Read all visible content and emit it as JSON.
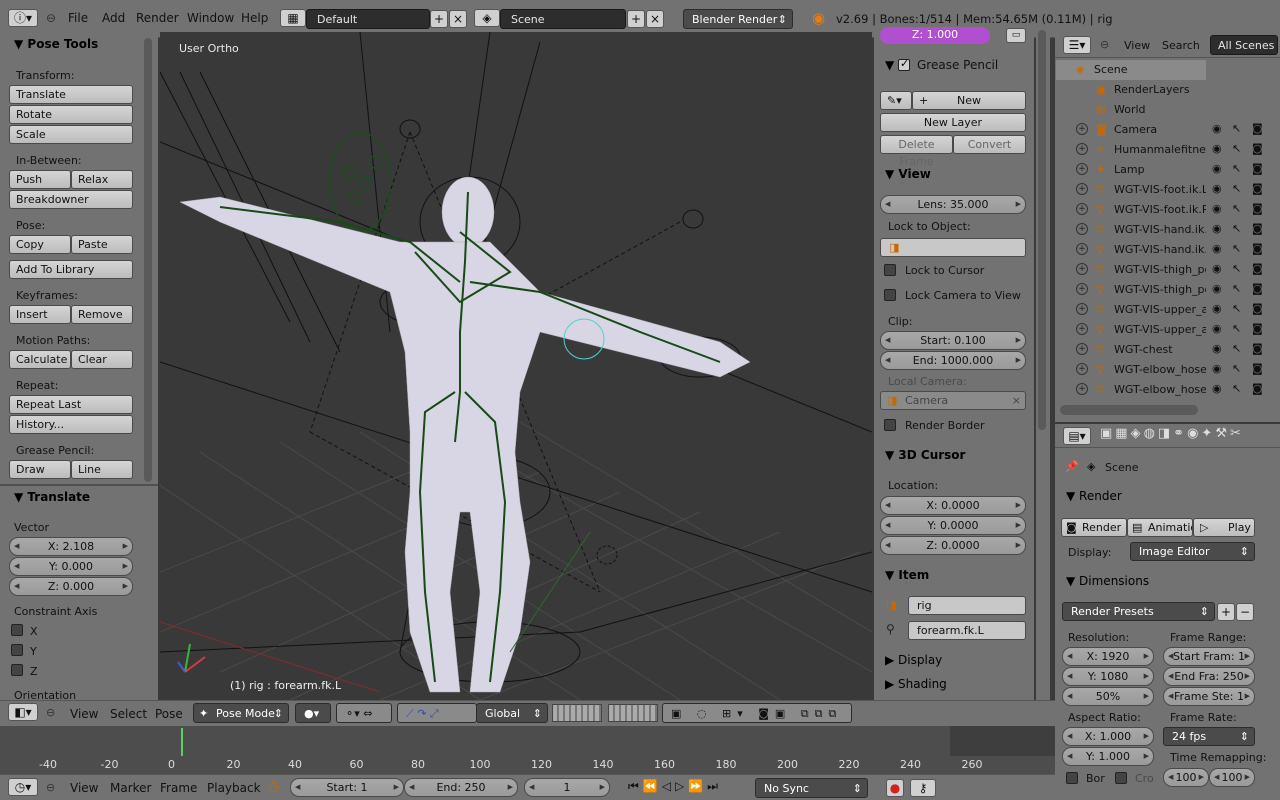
{
  "topbar": {
    "menus": [
      "File",
      "Add",
      "Render",
      "Window",
      "Help"
    ],
    "screen": "Default",
    "scene": "Scene",
    "engine": "Blender Render",
    "status": "v2.69 | Bones:1/514 | Mem:54.65M (0.11M) | rig"
  },
  "tools": {
    "title": "Pose Tools",
    "transform_label": "Transform:",
    "translate": "Translate",
    "rotate": "Rotate",
    "scale": "Scale",
    "inbetween_label": "In-Between:",
    "push": "Push",
    "relax": "Relax",
    "breakdowner": "Breakdowner",
    "pose_label": "Pose:",
    "copy": "Copy",
    "paste": "Paste",
    "add_to_library": "Add To Library",
    "keyframes_label": "Keyframes:",
    "insert": "Insert",
    "remove": "Remove",
    "motion_paths_label": "Motion Paths:",
    "calculate": "Calculate",
    "clear": "Clear",
    "repeat_label": "Repeat:",
    "repeat_last": "Repeat Last",
    "history": "History...",
    "grease_pencil_label": "Grease Pencil:",
    "draw": "Draw",
    "line": "Line"
  },
  "operator": {
    "title": "Translate",
    "vector_label": "Vector",
    "x": "X: 2.108",
    "y": "Y: 0.000",
    "z": "Z: 0.000",
    "constraint_label": "Constraint Axis",
    "cx": "X",
    "cy": "Y",
    "cz": "Z",
    "orientation_label": "Orientation"
  },
  "viewport": {
    "view_name": "User Ortho",
    "object_info": "(1) rig : forearm.fk.L"
  },
  "properties": {
    "z_field": "Z: 1.000",
    "grease_pencil": "Grease Pencil",
    "new": "New",
    "new_layer": "New Layer",
    "delete_frame": "Delete Frame",
    "convert": "Convert",
    "view": "View",
    "lens": "Lens: 35.000",
    "lock_to_object": "Lock to Object:",
    "lock_to_cursor": "Lock to Cursor",
    "lock_camera": "Lock Camera to View",
    "clip": "Clip:",
    "clip_start": "Start: 0.100",
    "clip_end": "End: 1000.000",
    "local_camera": "Local Camera:",
    "camera": "Camera",
    "render_border": "Render Border",
    "cursor_3d": "3D Cursor",
    "location": "Location:",
    "cx": "X: 0.0000",
    "cy": "Y: 0.0000",
    "cz": "Z: 0.0000",
    "item": "Item",
    "item_object": "rig",
    "item_bone": "forearm.fk.L",
    "display": "Display",
    "shading": "Shading"
  },
  "outliner": {
    "view": "View",
    "search": "Search",
    "all_scenes": "All Scenes",
    "rows": [
      "Scene",
      "RenderLayers",
      "World",
      "Camera",
      "Humanmalefitness",
      "Lamp",
      "WGT-VIS-foot.ik.L",
      "WGT-VIS-foot.ik.R",
      "WGT-VIS-hand.ik.L",
      "WGT-VIS-hand.ik.R",
      "WGT-VIS-thigh_pol",
      "WGT-VIS-thigh_pol",
      "WGT-VIS-upper_ar",
      "WGT-VIS-upper_ar",
      "WGT-chest",
      "WGT-elbow_hose.l",
      "WGT-elbow_hose.l"
    ]
  },
  "render_props": {
    "scene": "Scene",
    "render": "Render",
    "render_btn": "Render",
    "animation_btn": "Animatio",
    "play_btn": "Play",
    "display_label": "Display:",
    "display_value": "Image Editor",
    "dimensions": "Dimensions",
    "presets": "Render Presets",
    "resolution": "Resolution:",
    "res_x": "X: 1920",
    "res_y": "Y: 1080",
    "res_pct": "50%",
    "frame_range": "Frame Range:",
    "start_frame": "Start Fram: 1",
    "end_frame": "End Fra: 250",
    "frame_step": "Frame Ste: 1",
    "aspect_ratio": "Aspect Ratio:",
    "asp_x": "X: 1.000",
    "asp_y": "Y: 1.000",
    "frame_rate": "Frame Rate:",
    "fps": "24 fps",
    "time_remap": "Time Remapping:",
    "border": "Bor",
    "crop": "Cro",
    "remap_old": "100",
    "remap_new": "100"
  },
  "viewport_header": {
    "view": "View",
    "select": "Select",
    "pose": "Pose",
    "mode": "Pose Mode",
    "orientation": "Global"
  },
  "timeline": {
    "ticks": [
      "-40",
      "-20",
      "0",
      "20",
      "40",
      "60",
      "80",
      "100",
      "120",
      "140",
      "160",
      "180",
      "200",
      "220",
      "240",
      "260"
    ],
    "current_frame": 1
  },
  "bottombar": {
    "view": "View",
    "marker": "Marker",
    "frame": "Frame",
    "playback": "Playback",
    "start": "Start: 1",
    "end": "End: 250",
    "current": "1",
    "sync": "No Sync"
  }
}
